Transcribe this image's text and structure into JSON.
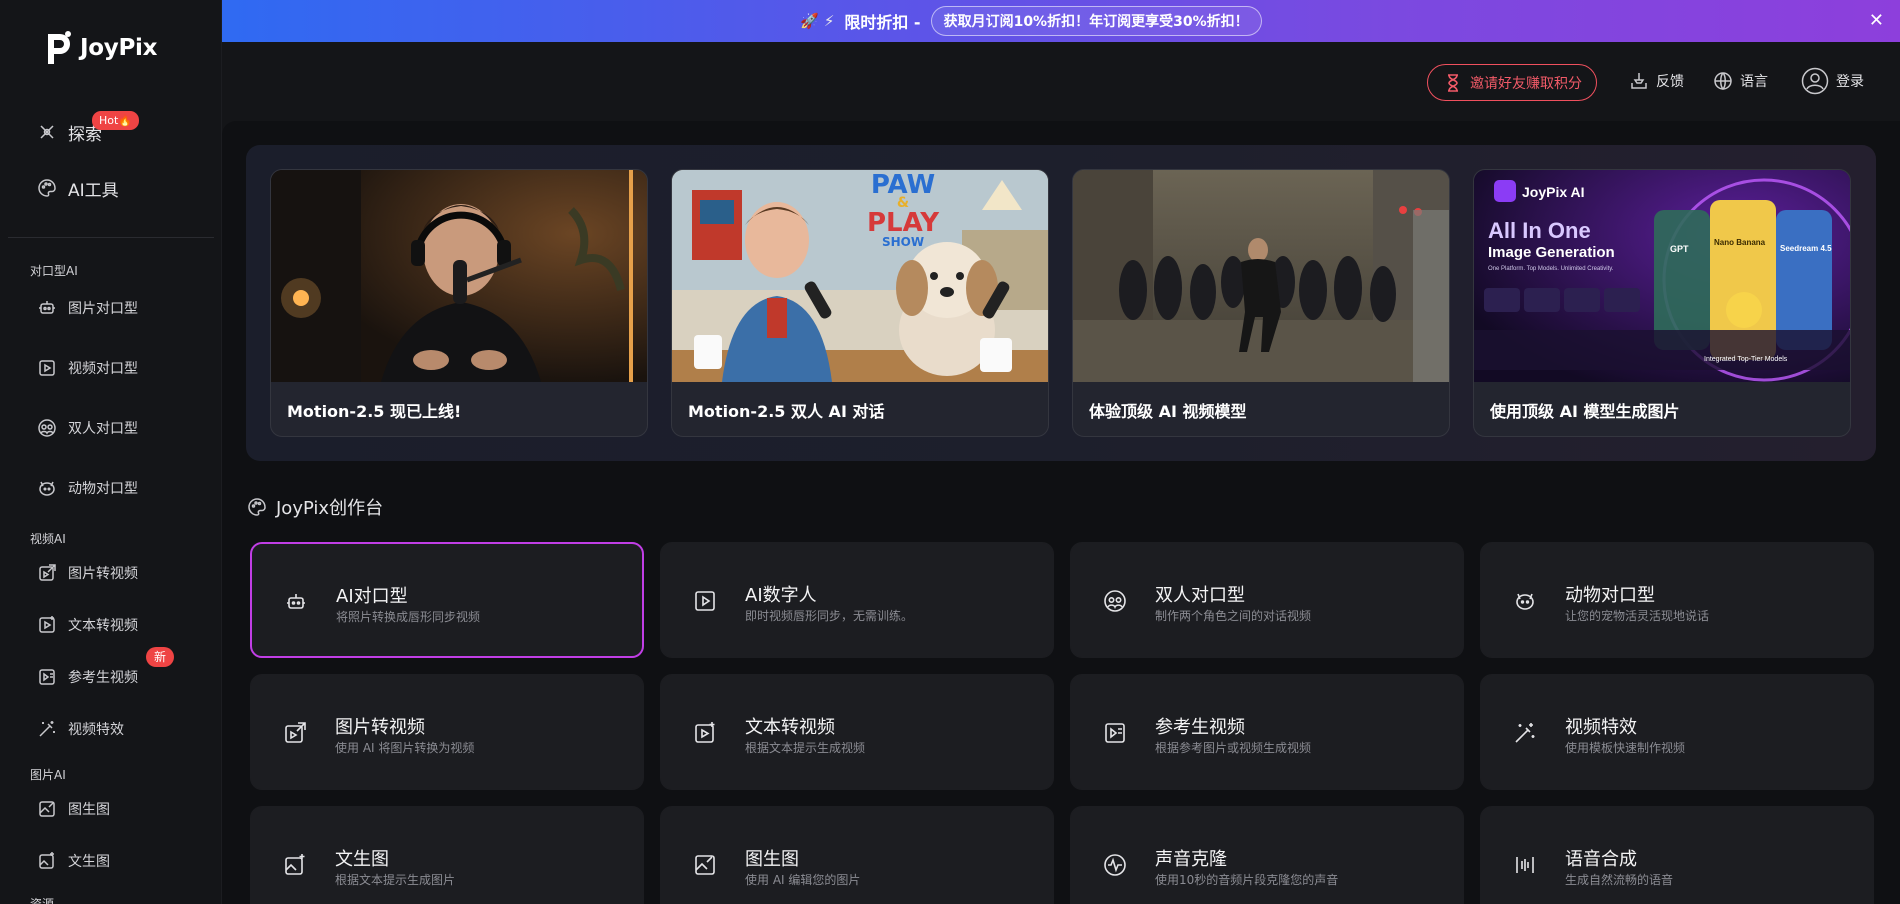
{
  "brand": {
    "name": "JoyPix"
  },
  "sidebar": {
    "main_items": [
      {
        "label": "探索",
        "icon": "compass-icon",
        "badge": "Hot🔥"
      },
      {
        "label": "AI工具",
        "icon": "palette-icon"
      }
    ],
    "sections": [
      {
        "title": "对口型AI",
        "items": [
          {
            "label": "图片对口型",
            "icon": "robot-icon"
          },
          {
            "label": "视频对口型",
            "icon": "video-play-icon"
          },
          {
            "label": "双人对口型",
            "icon": "two-faces-icon"
          },
          {
            "label": "动物对口型",
            "icon": "cat-icon"
          }
        ]
      },
      {
        "title": "视频AI",
        "items": [
          {
            "label": "图片转视频",
            "icon": "image-to-video-icon"
          },
          {
            "label": "文本转视频",
            "icon": "text-to-video-icon"
          },
          {
            "label": "参考生视频",
            "icon": "reference-video-icon",
            "badge": "新"
          },
          {
            "label": "视频特效",
            "icon": "magic-wand-icon"
          }
        ]
      },
      {
        "title": "图片AI",
        "items": [
          {
            "label": "图生图",
            "icon": "image-edit-icon"
          },
          {
            "label": "文生图",
            "icon": "image-text-icon"
          }
        ]
      },
      {
        "title": "资源"
      }
    ]
  },
  "promo": {
    "emoji": "🚀 ⚡",
    "title": "限时折扣 -",
    "pill": "获取月订阅10%折扣！年订阅更享受30%折扣！",
    "close": "✕"
  },
  "header": {
    "invite": "邀请好友赚取积分",
    "feedback": "反馈",
    "language": "语言",
    "login": "登录"
  },
  "hero_cards": [
    {
      "caption": "Motion-2.5 现已上线!"
    },
    {
      "caption": "Motion-2.5 双人 AI 对话",
      "art_text": [
        "PAW",
        "&",
        "PLAY",
        "SHOW"
      ]
    },
    {
      "caption": "体验顶级 AI 视频模型"
    },
    {
      "caption": "使用顶级 AI 模型生成图片",
      "art_text": [
        "JoyPix AI",
        "All In One",
        "Image Generation",
        "One Platform. Top Models. Unlimited Creativity.",
        "GPT",
        "Nano Banana",
        "Seedream 4.5",
        "Integrated Top-Tier Models"
      ]
    }
  ],
  "studio": {
    "title": "JoyPix创作台",
    "tools": [
      {
        "name": "AI对口型",
        "desc": "将照片转换成唇形同步视频",
        "icon": "robot-icon",
        "active": true
      },
      {
        "name": "AI数字人",
        "desc": "即时视频唇形同步，无需训练。",
        "icon": "video-play-icon"
      },
      {
        "name": "双人对口型",
        "desc": "制作两个角色之间的对话视频",
        "icon": "two-faces-icon"
      },
      {
        "name": "动物对口型",
        "desc": "让您的宠物活灵活现地说话",
        "icon": "cat-icon"
      },
      {
        "name": "图片转视频",
        "desc": "使用 AI 将图片转换为视频",
        "icon": "image-to-video-icon"
      },
      {
        "name": "文本转视频",
        "desc": "根据文本提示生成视频",
        "icon": "text-to-video-icon"
      },
      {
        "name": "参考生视频",
        "desc": "根据参考图片或视频生成视频",
        "icon": "reference-video-icon"
      },
      {
        "name": "视频特效",
        "desc": "使用模板快速制作视频",
        "icon": "magic-wand-icon"
      },
      {
        "name": "文生图",
        "desc": "根据文本提示生成图片",
        "icon": "image-text-icon"
      },
      {
        "name": "图生图",
        "desc": "使用 AI 编辑您的图片",
        "icon": "image-edit-icon"
      },
      {
        "name": "声音克隆",
        "desc": "使用10秒的音频片段克隆您的声音",
        "icon": "waveform-icon"
      },
      {
        "name": "语音合成",
        "desc": "生成自然流畅的语音",
        "icon": "audio-bars-icon"
      }
    ]
  }
}
